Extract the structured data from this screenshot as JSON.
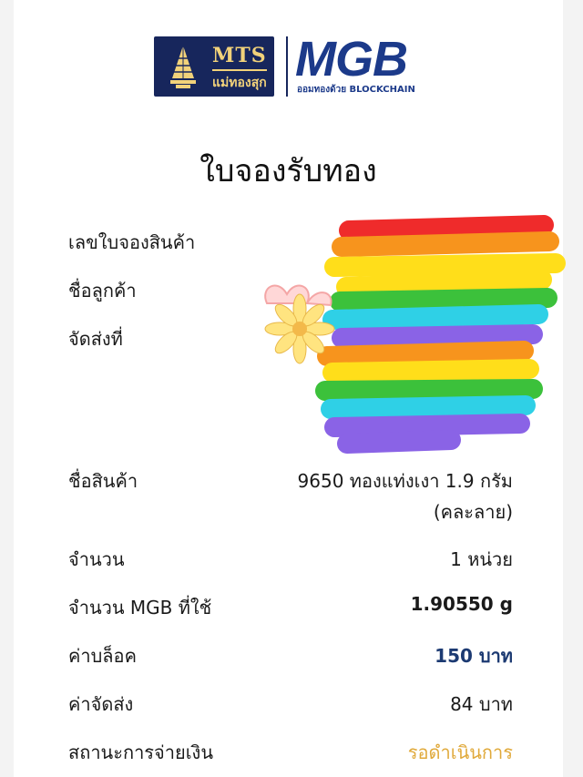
{
  "logo": {
    "mts_text": "MTS",
    "mts_thai": "แม่ทองสุก",
    "mgb_text": "MGB",
    "mgb_tagline": "ออมทองด้วย BLOCKCHAIN"
  },
  "title": "ใบจองรับทอง",
  "rows": [
    {
      "label": "เลขใบจองสินค้า",
      "value": ""
    },
    {
      "label": "ชื่อลูกค้า",
      "value": ""
    },
    {
      "label": "จัดส่งที่",
      "value": ""
    },
    {
      "label": "ชื่อสินค้า",
      "value_line1": "9650 ทองแท่งเงา 1.9 กรัม",
      "value_line2": "(คละลาย)"
    },
    {
      "label": "จำนวน",
      "value": "1 หน่วย"
    },
    {
      "label": "จำนวน MGB ที่ใช้",
      "value": "1.90550 g"
    },
    {
      "label": "ค่าบล็อค",
      "value": "150 บาท"
    },
    {
      "label": "ค่าจัดส่ง",
      "value": "84 บาท"
    },
    {
      "label": "สถานะการจ่ายเงิน",
      "value": "รอดำเนินการ"
    }
  ],
  "colors": {
    "brand_navy": "#17265c",
    "brand_blue": "#1c3a8a",
    "gold": "#f2d27a",
    "fee_blue": "#1c3a72",
    "status_orange": "#e0a93a"
  }
}
